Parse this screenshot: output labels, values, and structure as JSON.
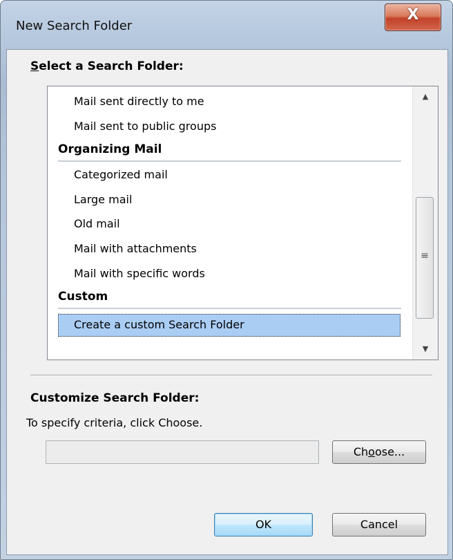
{
  "window": {
    "title": "New Search Folder",
    "close_label": "X"
  },
  "select_section": {
    "label_accel": "S",
    "label_rest": "elect a Search Folder:"
  },
  "list": {
    "groups": [
      {
        "header": "",
        "items": [
          "Mail sent directly to me",
          "Mail sent to public groups"
        ]
      },
      {
        "header": "Organizing Mail",
        "items": [
          "Categorized mail",
          "Large mail",
          "Old mail",
          "Mail with attachments",
          "Mail with specific words"
        ]
      },
      {
        "header": "Custom",
        "items": [
          "Create a custom Search Folder"
        ]
      }
    ],
    "selected_item": "Create a custom Search Folder",
    "scroll_position": 0.8
  },
  "customize_section": {
    "label": "Customize Search Folder:",
    "hint": "To specify criteria, click Choose.",
    "criteria_value": ""
  },
  "buttons": {
    "choose_accel": "o",
    "choose_pre": "Ch",
    "choose_post": "ose...",
    "ok_label": "OK",
    "cancel_label": "Cancel"
  },
  "icons": {
    "scroll_up": "triangle-up-icon",
    "scroll_down": "triangle-down-icon",
    "scroll_grip": "grip-icon"
  }
}
